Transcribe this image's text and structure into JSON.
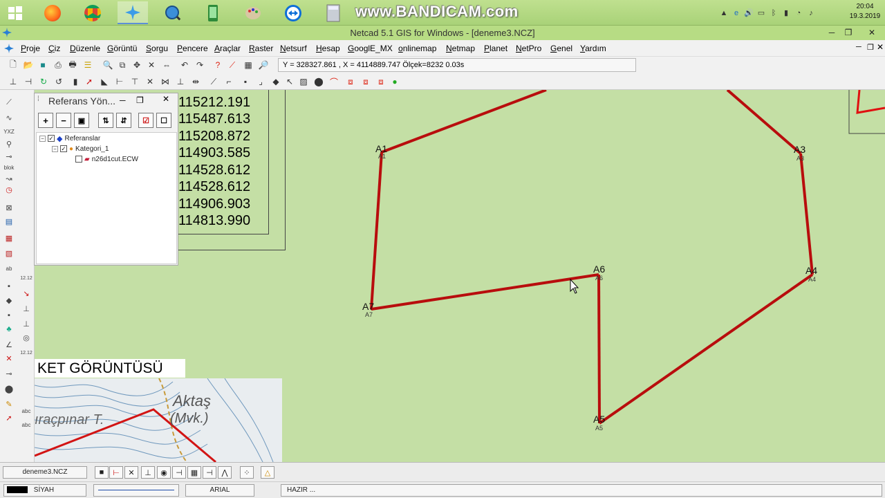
{
  "taskbar": {
    "watermark": "www.BANDICAM.com",
    "clock_time": "20:04",
    "clock_date": "19.3.2019",
    "apps": [
      "windows-start",
      "firefox",
      "chrome",
      "netcad",
      "search-app",
      "phone-app",
      "paint",
      "teamviewer",
      "calculator"
    ]
  },
  "window": {
    "title": "Netcad 5.1 GIS for Windows - [deneme3.NCZ]",
    "minimize": "─",
    "restore": "❐",
    "close": "✕"
  },
  "menu": [
    "Proje",
    "Çiz",
    "Düzenle",
    "Görüntü",
    "Sorgu",
    "Pencere",
    "Araçlar",
    "Raster",
    "Netsurf",
    "Hesap",
    "GooglE_MX",
    "onlinemap",
    "Netmap",
    "Planet",
    "NetPro",
    "Genel",
    "Yardım"
  ],
  "coord_readout": "Y = 328327.861 , X = 4114889.747  Ölçek=8232  0.03s",
  "coord_table": {
    "values": [
      "115212.191",
      "115487.613",
      "115208.872",
      "114903.585",
      "114528.612",
      "114528.612",
      "114906.903",
      "114813.990"
    ]
  },
  "ref_panel": {
    "title": "Referans Yön...",
    "minimize": "─",
    "restore": "❐",
    "close": "✕",
    "tree": {
      "root": "Referanslar",
      "category": "Kategori_1",
      "file": "n26d1cut.ECW"
    }
  },
  "map": {
    "points": [
      {
        "label": "A1",
        "sub": "A1"
      },
      {
        "label": "A3",
        "sub": "A3"
      },
      {
        "label": "A4",
        "sub": "A4"
      },
      {
        "label": "A5",
        "sub": "A5"
      },
      {
        "label": "A6",
        "sub": "A6"
      },
      {
        "label": "A7",
        "sub": "A7"
      }
    ],
    "line_color": "#b30000"
  },
  "paket": {
    "label": "KET GÖRÜNTÜSÜ",
    "map_text1": "Aktaş",
    "map_text2": "(Mvk.)",
    "map_text3": "ıraçpınar T."
  },
  "status": {
    "tab": "deneme3.NCZ",
    "color_name": "SİYAH",
    "font_name": "ARIAL",
    "state": "HAZIR ..."
  }
}
